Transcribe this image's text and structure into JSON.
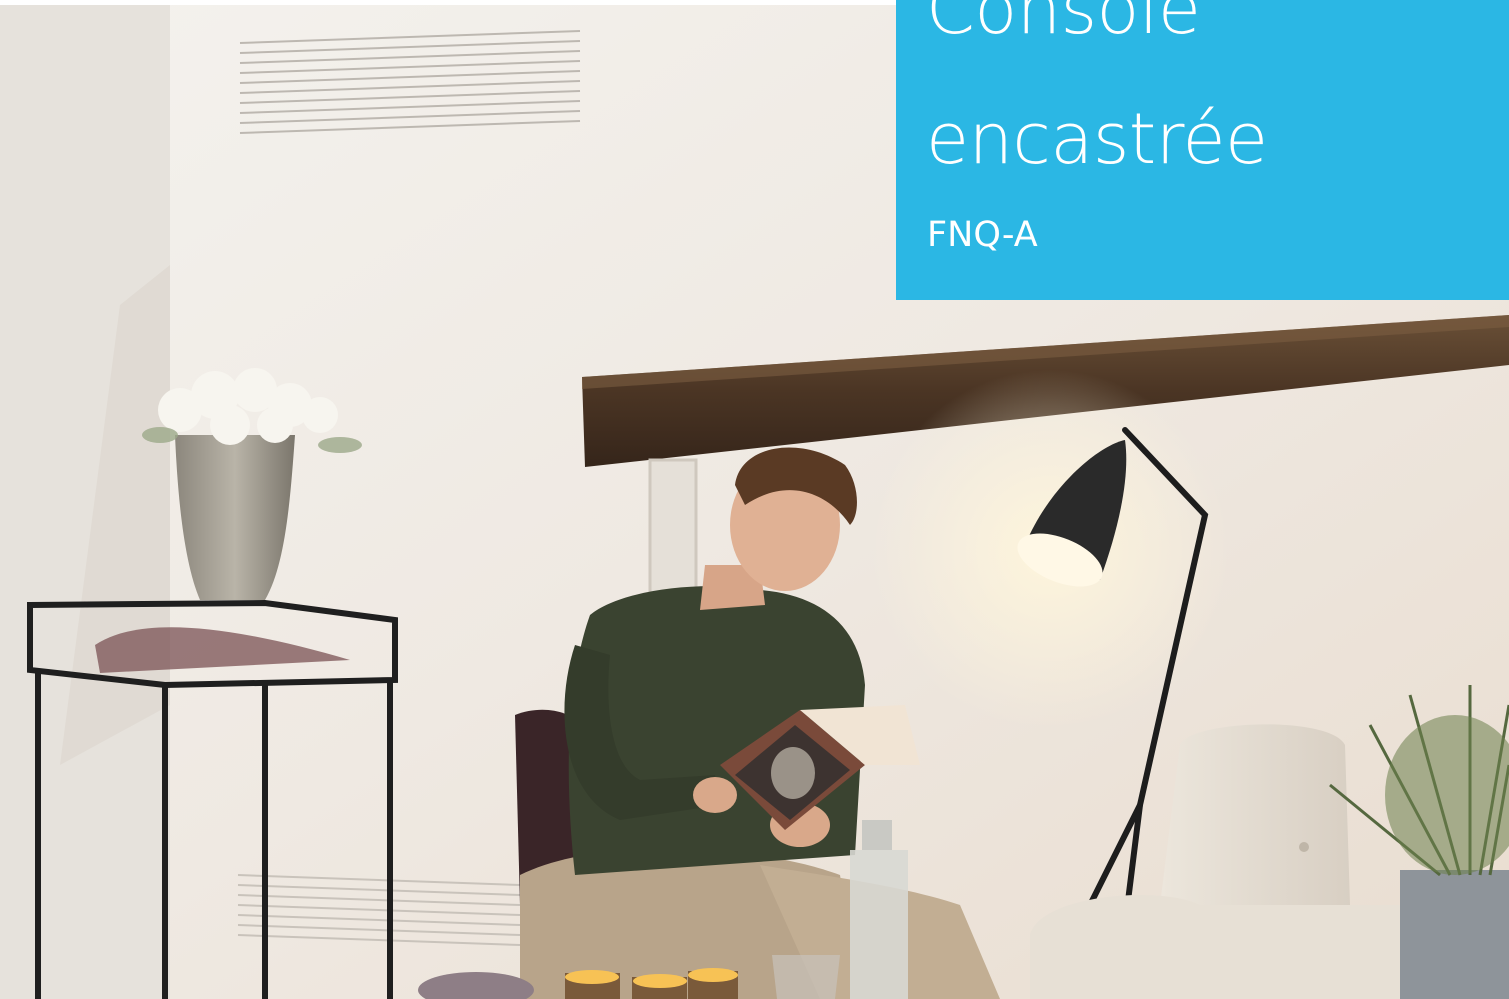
{
  "banner": {
    "title_line_1": "Console",
    "title_line_2": "encastrée",
    "subtitle": "FNQ-A",
    "background_color": "#2bb7e4",
    "text_color": "#ffffff"
  },
  "photo": {
    "subject": "person-reading-icon"
  }
}
